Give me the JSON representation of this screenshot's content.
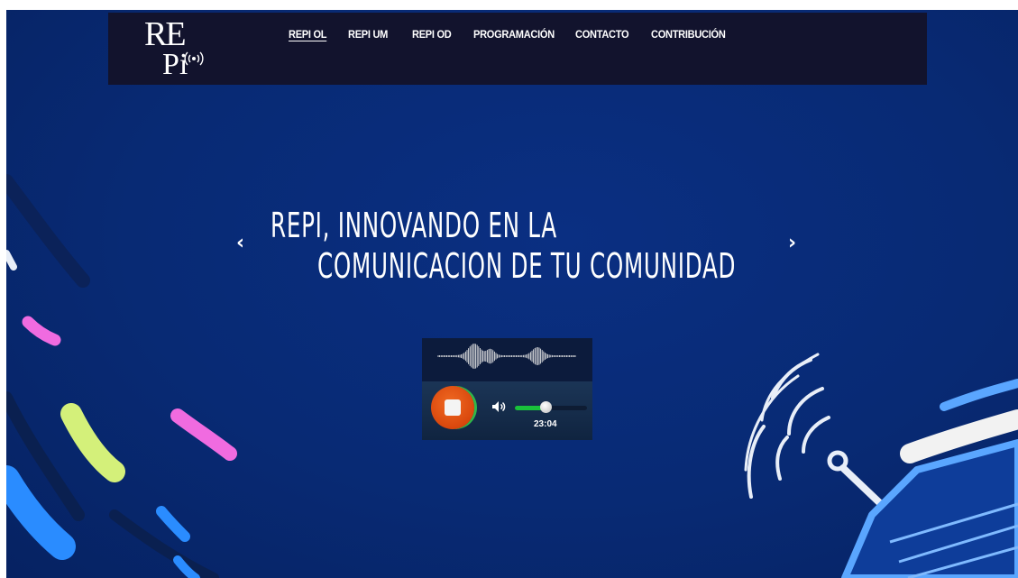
{
  "logo": {
    "letters_top": "RE",
    "letters_bottom": "Pi"
  },
  "nav": {
    "items": [
      {
        "label": "REPI OL",
        "active": true
      },
      {
        "label": "REPI UM",
        "active": false
      },
      {
        "label": "REPI OD",
        "active": false
      },
      {
        "label": "PROGRAMACIÓN",
        "active": false
      },
      {
        "label": "CONTACTO",
        "active": false
      },
      {
        "label": "CONTRIBUCIÓN",
        "active": false
      }
    ]
  },
  "slider": {
    "prev_arrow": "‹",
    "next_arrow": "›",
    "headline_line1": "REPI, INNOVANDO EN LA",
    "headline_line2": "COMUNICACION DE TU COMUNIDAD"
  },
  "player": {
    "elapsed": "23:04",
    "volume": 0.42,
    "state": "playing"
  },
  "colors": {
    "background": "#082a74",
    "navbar": "#12132d",
    "stop_button": "#e1530f",
    "volume_fill": "#19c13b",
    "brush_pink": "#f06be0",
    "brush_lime": "#d4f07a",
    "brush_blue": "#2a8cff"
  }
}
